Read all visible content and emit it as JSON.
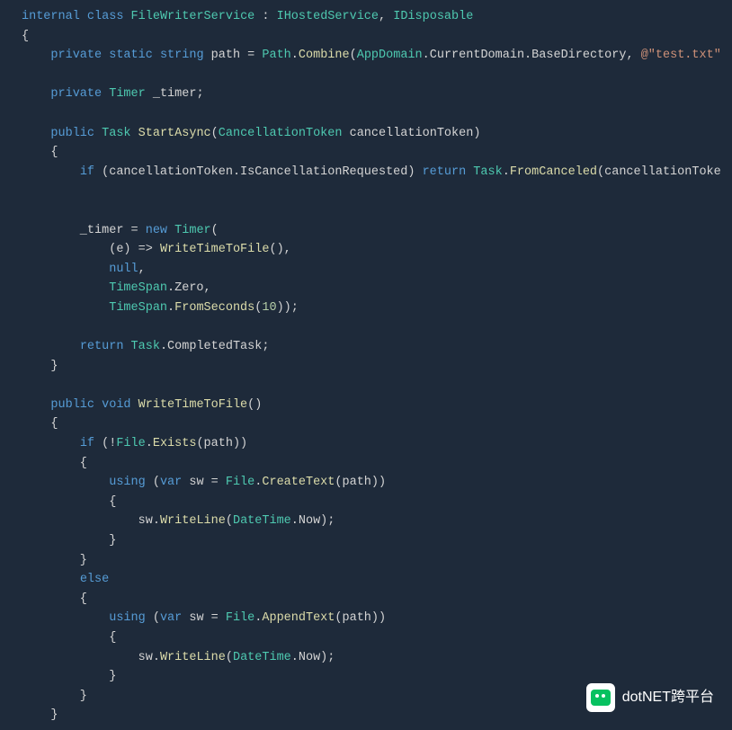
{
  "code": {
    "tokens": [
      [
        {
          "t": "internal",
          "c": "keyword"
        },
        {
          "t": " ",
          "c": "punct"
        },
        {
          "t": "class",
          "c": "keyword"
        },
        {
          "t": " ",
          "c": "punct"
        },
        {
          "t": "FileWriterService",
          "c": "type"
        },
        {
          "t": " : ",
          "c": "punct"
        },
        {
          "t": "IHostedService",
          "c": "type"
        },
        {
          "t": ", ",
          "c": "punct"
        },
        {
          "t": "IDisposable",
          "c": "type"
        }
      ],
      [
        {
          "t": "{",
          "c": "punct"
        }
      ],
      [
        {
          "t": "    ",
          "c": "punct"
        },
        {
          "t": "private",
          "c": "keyword"
        },
        {
          "t": " ",
          "c": "punct"
        },
        {
          "t": "static",
          "c": "keyword"
        },
        {
          "t": " ",
          "c": "punct"
        },
        {
          "t": "string",
          "c": "keyword"
        },
        {
          "t": " path = ",
          "c": "ident"
        },
        {
          "t": "Path",
          "c": "type"
        },
        {
          "t": ".",
          "c": "punct"
        },
        {
          "t": "Combine",
          "c": "method"
        },
        {
          "t": "(",
          "c": "punct"
        },
        {
          "t": "AppDomain",
          "c": "type"
        },
        {
          "t": ".CurrentDomain.BaseDirectory, ",
          "c": "ident"
        },
        {
          "t": "@\"test.txt\"",
          "c": "string"
        }
      ],
      [
        {
          "t": "",
          "c": "punct"
        }
      ],
      [
        {
          "t": "    ",
          "c": "punct"
        },
        {
          "t": "private",
          "c": "keyword"
        },
        {
          "t": " ",
          "c": "punct"
        },
        {
          "t": "Timer",
          "c": "type"
        },
        {
          "t": " _timer;",
          "c": "ident"
        }
      ],
      [
        {
          "t": "",
          "c": "punct"
        }
      ],
      [
        {
          "t": "    ",
          "c": "punct"
        },
        {
          "t": "public",
          "c": "keyword"
        },
        {
          "t": " ",
          "c": "punct"
        },
        {
          "t": "Task",
          "c": "type"
        },
        {
          "t": " ",
          "c": "punct"
        },
        {
          "t": "StartAsync",
          "c": "method"
        },
        {
          "t": "(",
          "c": "punct"
        },
        {
          "t": "CancellationToken",
          "c": "type"
        },
        {
          "t": " cancellationToken)",
          "c": "ident"
        }
      ],
      [
        {
          "t": "    {",
          "c": "punct"
        }
      ],
      [
        {
          "t": "        ",
          "c": "punct"
        },
        {
          "t": "if",
          "c": "keyword"
        },
        {
          "t": " (cancellationToken.IsCancellationRequested) ",
          "c": "ident"
        },
        {
          "t": "return",
          "c": "keyword"
        },
        {
          "t": " ",
          "c": "punct"
        },
        {
          "t": "Task",
          "c": "type"
        },
        {
          "t": ".",
          "c": "punct"
        },
        {
          "t": "FromCanceled",
          "c": "method"
        },
        {
          "t": "(cancellationToke",
          "c": "ident"
        }
      ],
      [
        {
          "t": "",
          "c": "punct"
        }
      ],
      [
        {
          "t": "",
          "c": "punct"
        }
      ],
      [
        {
          "t": "        _timer = ",
          "c": "ident"
        },
        {
          "t": "new",
          "c": "keyword"
        },
        {
          "t": " ",
          "c": "punct"
        },
        {
          "t": "Timer",
          "c": "type"
        },
        {
          "t": "(",
          "c": "punct"
        }
      ],
      [
        {
          "t": "            (e) => ",
          "c": "ident"
        },
        {
          "t": "WriteTimeToFile",
          "c": "method"
        },
        {
          "t": "(),",
          "c": "punct"
        }
      ],
      [
        {
          "t": "            ",
          "c": "punct"
        },
        {
          "t": "null",
          "c": "keyword"
        },
        {
          "t": ",",
          "c": "punct"
        }
      ],
      [
        {
          "t": "            ",
          "c": "punct"
        },
        {
          "t": "TimeSpan",
          "c": "type"
        },
        {
          "t": ".Zero,",
          "c": "ident"
        }
      ],
      [
        {
          "t": "            ",
          "c": "punct"
        },
        {
          "t": "TimeSpan",
          "c": "type"
        },
        {
          "t": ".",
          "c": "punct"
        },
        {
          "t": "FromSeconds",
          "c": "method"
        },
        {
          "t": "(",
          "c": "punct"
        },
        {
          "t": "10",
          "c": "number"
        },
        {
          "t": "));",
          "c": "punct"
        }
      ],
      [
        {
          "t": "",
          "c": "punct"
        }
      ],
      [
        {
          "t": "        ",
          "c": "punct"
        },
        {
          "t": "return",
          "c": "keyword"
        },
        {
          "t": " ",
          "c": "punct"
        },
        {
          "t": "Task",
          "c": "type"
        },
        {
          "t": ".CompletedTask;",
          "c": "ident"
        }
      ],
      [
        {
          "t": "    }",
          "c": "punct"
        }
      ],
      [
        {
          "t": "",
          "c": "punct"
        }
      ],
      [
        {
          "t": "    ",
          "c": "punct"
        },
        {
          "t": "public",
          "c": "keyword"
        },
        {
          "t": " ",
          "c": "punct"
        },
        {
          "t": "void",
          "c": "keyword"
        },
        {
          "t": " ",
          "c": "punct"
        },
        {
          "t": "WriteTimeToFile",
          "c": "method"
        },
        {
          "t": "()",
          "c": "punct"
        }
      ],
      [
        {
          "t": "    {",
          "c": "punct"
        }
      ],
      [
        {
          "t": "        ",
          "c": "punct"
        },
        {
          "t": "if",
          "c": "keyword"
        },
        {
          "t": " (!",
          "c": "punct"
        },
        {
          "t": "File",
          "c": "type"
        },
        {
          "t": ".",
          "c": "punct"
        },
        {
          "t": "Exists",
          "c": "method"
        },
        {
          "t": "(path))",
          "c": "ident"
        }
      ],
      [
        {
          "t": "        {",
          "c": "punct"
        }
      ],
      [
        {
          "t": "            ",
          "c": "punct"
        },
        {
          "t": "using",
          "c": "keyword"
        },
        {
          "t": " (",
          "c": "punct"
        },
        {
          "t": "var",
          "c": "keyword"
        },
        {
          "t": " sw = ",
          "c": "ident"
        },
        {
          "t": "File",
          "c": "type"
        },
        {
          "t": ".",
          "c": "punct"
        },
        {
          "t": "CreateText",
          "c": "method"
        },
        {
          "t": "(path))",
          "c": "ident"
        }
      ],
      [
        {
          "t": "            {",
          "c": "punct"
        }
      ],
      [
        {
          "t": "                sw.",
          "c": "ident"
        },
        {
          "t": "WriteLine",
          "c": "method"
        },
        {
          "t": "(",
          "c": "punct"
        },
        {
          "t": "DateTime",
          "c": "type"
        },
        {
          "t": ".Now);",
          "c": "ident"
        }
      ],
      [
        {
          "t": "            }",
          "c": "punct"
        }
      ],
      [
        {
          "t": "        }",
          "c": "punct"
        }
      ],
      [
        {
          "t": "        ",
          "c": "punct"
        },
        {
          "t": "else",
          "c": "keyword"
        }
      ],
      [
        {
          "t": "        {",
          "c": "punct"
        }
      ],
      [
        {
          "t": "            ",
          "c": "punct"
        },
        {
          "t": "using",
          "c": "keyword"
        },
        {
          "t": " (",
          "c": "punct"
        },
        {
          "t": "var",
          "c": "keyword"
        },
        {
          "t": " sw = ",
          "c": "ident"
        },
        {
          "t": "File",
          "c": "type"
        },
        {
          "t": ".",
          "c": "punct"
        },
        {
          "t": "AppendText",
          "c": "method"
        },
        {
          "t": "(path))",
          "c": "ident"
        }
      ],
      [
        {
          "t": "            {",
          "c": "punct"
        }
      ],
      [
        {
          "t": "                sw.",
          "c": "ident"
        },
        {
          "t": "WriteLine",
          "c": "method"
        },
        {
          "t": "(",
          "c": "punct"
        },
        {
          "t": "DateTime",
          "c": "type"
        },
        {
          "t": ".Now);",
          "c": "ident"
        }
      ],
      [
        {
          "t": "            }",
          "c": "punct"
        }
      ],
      [
        {
          "t": "        }",
          "c": "punct"
        }
      ],
      [
        {
          "t": "    }",
          "c": "punct"
        }
      ]
    ]
  },
  "watermark": {
    "text": "dotNET跨平台"
  }
}
